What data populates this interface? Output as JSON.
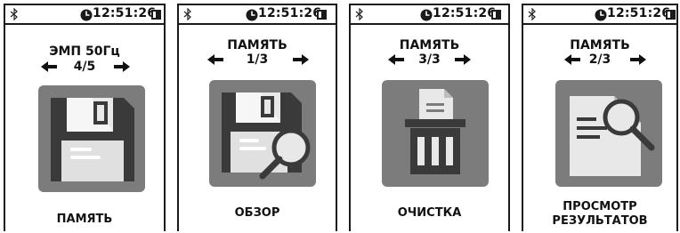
{
  "screens": [
    {
      "status": {
        "time": "12:51:26"
      },
      "title": "ЭМП 50Гц",
      "counter": "4/5",
      "icon": "floppy-disk-icon",
      "caption_lines": [
        "ПАМЯТЬ"
      ]
    },
    {
      "status": {
        "time": "12:51:26"
      },
      "title": "ПАМЯТЬ",
      "counter": "1/3",
      "icon": "floppy-magnifier-icon",
      "caption_lines": [
        "ОБЗОР"
      ]
    },
    {
      "status": {
        "time": "12:51:26"
      },
      "title": "ПАМЯТЬ",
      "counter": "3/3",
      "icon": "trash-document-icon",
      "caption_lines": [
        "ОЧИСТКА"
      ]
    },
    {
      "status": {
        "time": "12:51:26"
      },
      "title": "ПАМЯТЬ",
      "counter": "2/3",
      "icon": "document-magnifier-icon",
      "caption_lines": [
        "ПРОСМОТР",
        "РЕЗУЛЬТАТОВ"
      ]
    }
  ],
  "colors": {
    "tile": "#7c7c7c",
    "dark": "#3a3a3a",
    "light": "#e8e8e8",
    "frame": "#1a1a1a"
  }
}
